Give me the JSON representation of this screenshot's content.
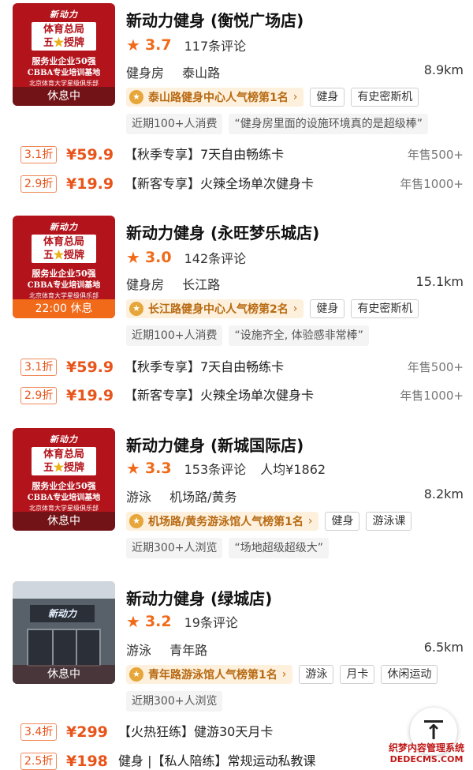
{
  "stores": [
    {
      "thumb": {
        "brand": "新动力",
        "auth_line1": "体育总局",
        "auth_line2_a": "五",
        "auth_line2_b": "授牌",
        "line1": "服务业企业50强",
        "line2": "CBBA专业培训基地",
        "line3": "北京体育大学星级俱乐部",
        "status": "休息中"
      },
      "name": "新动力健身 (衡悦广场店)",
      "score": "3.7",
      "reviews": "117条评论",
      "category": "健身房",
      "area": "泰山路",
      "distance": "8.9km",
      "rank": "泰山路健身中心人气榜第1名",
      "tags": [
        "健身",
        "有史密斯机"
      ],
      "info": [
        "近期100+人消费",
        "“健身房里面的设施环境真的是超级棒”"
      ],
      "deals": [
        {
          "discount": "3.1折",
          "price": "¥59.9",
          "title": "【秋季专享】7天自由畅练卡",
          "sold": "年售500+"
        },
        {
          "discount": "2.9折",
          "price": "¥19.9",
          "title": "【新客专享】火辣全场单次健身卡",
          "sold": "年售1000+"
        }
      ]
    },
    {
      "thumb": {
        "brand": "新动力",
        "auth_line1": "体育总局",
        "auth_line2_a": "五",
        "auth_line2_b": "授牌",
        "line1": "服务业企业50强",
        "line2": "CBBA专业培训基地",
        "line3": "北京体育大学星级俱乐部",
        "status": "22:00 休息"
      },
      "name": "新动力健身 (永旺梦乐城店)",
      "score": "3.0",
      "reviews": "142条评论",
      "category": "健身房",
      "area": "长江路",
      "distance": "15.1km",
      "rank": "长江路健身中心人气榜第2名",
      "tags": [
        "健身",
        "有史密斯机"
      ],
      "info": [
        "近期100+人消费",
        "“设施齐全, 体验感非常棒”"
      ],
      "deals": [
        {
          "discount": "3.1折",
          "price": "¥59.9",
          "title": "【秋季专享】7天自由畅练卡",
          "sold": "年售500+"
        },
        {
          "discount": "2.9折",
          "price": "¥19.9",
          "title": "【新客专享】火辣全场单次健身卡",
          "sold": "年售1000+"
        }
      ]
    },
    {
      "thumb": {
        "brand": "新动力",
        "auth_line1": "体育总局",
        "auth_line2_a": "五",
        "auth_line2_b": "授牌",
        "line1": "服务业企业50强",
        "line2": "CBBA专业培训基地",
        "line3": "北京体育大学星级俱乐部",
        "status": "休息中"
      },
      "name": "新动力健身 (新城国际店)",
      "score": "3.3",
      "reviews": "153条评论",
      "avg_price": "人均¥1862",
      "category": "游泳",
      "area": "机场路/黄务",
      "distance": "8.2km",
      "rank": "机场路/黄务游泳馆人气榜第1名",
      "tags": [
        "健身",
        "游泳课"
      ],
      "info": [
        "近期300+人浏览",
        "“场地超级超级大”"
      ]
    },
    {
      "thumb": {
        "sign": "新动力",
        "status": "休息中"
      },
      "name": "新动力健身 (绿城店)",
      "score": "3.2",
      "reviews": "19条评论",
      "category": "游泳",
      "area": "青年路",
      "distance": "6.5km",
      "rank": "青年路游泳馆人气榜第1名",
      "tags": [
        "游泳",
        "月卡",
        "休闲运动"
      ],
      "info": [
        "近期300+人浏览"
      ],
      "deals": [
        {
          "discount": "3.4折",
          "price": "¥299",
          "title": "【火热狂练】健游30天月卡"
        },
        {
          "discount": "2.5折",
          "price": "¥198",
          "title": "健身 |【私人陪练】常规运动私教课"
        }
      ]
    }
  ],
  "icons": {
    "rating": "star-icon",
    "rank": "medal-icon",
    "rank_more": "chevron-right-icon",
    "back_to_top": "arrow-up-icon"
  },
  "colors": {
    "accent": "#f06a1a",
    "price": "#e8541a",
    "thumb_red": "#b3141c",
    "rank_bg": "#fdf0dc",
    "rank_text": "#b86a12"
  },
  "watermark": {
    "line1": "织梦内容管理系统",
    "line2": "DEDECMS.COM"
  }
}
